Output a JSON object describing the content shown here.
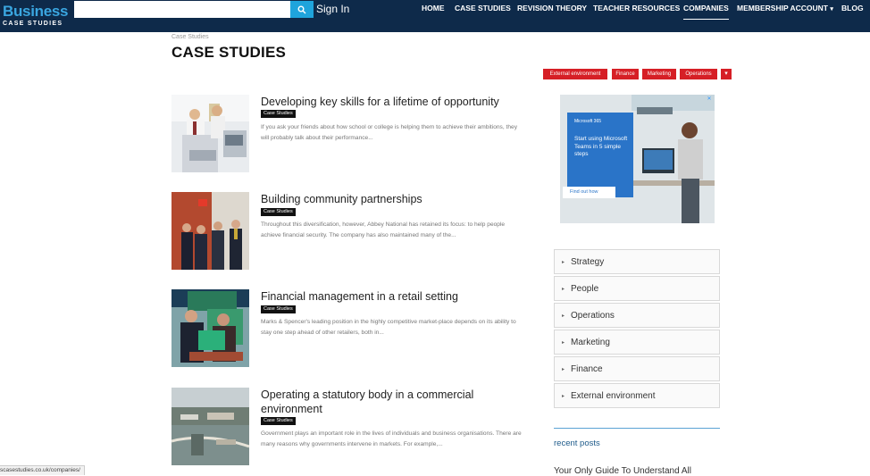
{
  "header": {
    "logo_line1": "Business",
    "logo_line2": "CASE STUDIES",
    "search_placeholder": "",
    "signin_label": "Sign In",
    "nav": [
      {
        "label": "HOME"
      },
      {
        "label": "CASE STUDIES"
      },
      {
        "label": "REVISION THEORY"
      },
      {
        "label": "TEACHER RESOURCES"
      },
      {
        "label": "COMPANIES"
      },
      {
        "label": "MEMBERSHIP ACCOUNT"
      },
      {
        "label": "BLOG"
      }
    ],
    "colors": {
      "bar": "#0e2a4a",
      "search_button": "#1fa4dc",
      "logo_accent": "#3aa6e0"
    }
  },
  "page": {
    "breadcrumb": "Case Studies",
    "title": "CASE STUDIES"
  },
  "tags": [
    {
      "label": "External environment"
    },
    {
      "label": "Finance"
    },
    {
      "label": "Marketing"
    },
    {
      "label": "Operations"
    }
  ],
  "tag_color": "#d61f26",
  "articles": [
    {
      "title": "Developing key skills for a lifetime of opportunity",
      "badge": "Case Studies",
      "excerpt": "If you ask your friends about how school or college is helping them to achieve their ambitions, they will probably talk about their performance..."
    },
    {
      "title": "Building community partnerships",
      "badge": "Case Studies",
      "excerpt": "Throughout this diversification, however, Abbey National has retained its focus: to help people achieve financial security. The company has also maintained many of the..."
    },
    {
      "title": "Financial management in a retail setting",
      "badge": "Case Studies",
      "excerpt": "Marks & Spencer's leading position in the highly competitive market-place depends on its ability to stay one step ahead of other retailers, both in..."
    },
    {
      "title": "Operating a statutory body in a commercial environment",
      "badge": "Case Studies",
      "excerpt": "Government plays an important role in the lives of individuals and business organisations. There are many reasons why governments intervene in markets. For example,..."
    }
  ],
  "ad": {
    "brand": "Microsoft 365",
    "text": "Start using Microsoft Teams in 5 simple steps",
    "cta": "Find out how"
  },
  "sidebar": {
    "categories": [
      {
        "label": "Strategy"
      },
      {
        "label": "People"
      },
      {
        "label": "Operations"
      },
      {
        "label": "Marketing"
      },
      {
        "label": "Finance"
      },
      {
        "label": "External environment"
      }
    ],
    "recent_title": "recent posts",
    "recent_first": "Your Only Guide To Understand All"
  },
  "status_bar": {
    "url": "scasestudies.co.uk/companies/"
  }
}
